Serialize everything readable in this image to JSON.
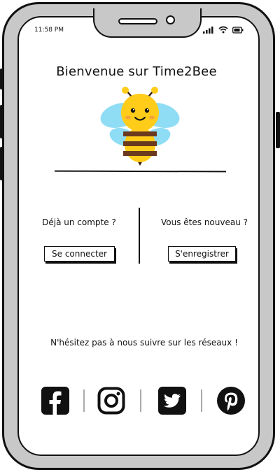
{
  "status_bar": {
    "time": "11:58 PM",
    "icons": [
      "signal-icon",
      "wifi-icon",
      "battery-icon"
    ]
  },
  "welcome": {
    "title": "Bienvenue sur Time2Bee",
    "logo": "bee-icon"
  },
  "login_section": {
    "question": "Déjà un compte ?",
    "button": "Se connecter"
  },
  "register_section": {
    "question": "Vous êtes nouveau ?",
    "button": "S'enregistrer"
  },
  "social": {
    "prompt": "N'hésitez pas à nous suivre sur les réseaux !",
    "networks": [
      "facebook-icon",
      "instagram-icon",
      "twitter-icon",
      "pinterest-icon"
    ]
  },
  "colors": {
    "bee_yellow": "#FFCC1A",
    "bee_brown": "#6B3A1E",
    "wing_blue": "#8FDCF5",
    "frame_gray": "#C8C8C8"
  }
}
